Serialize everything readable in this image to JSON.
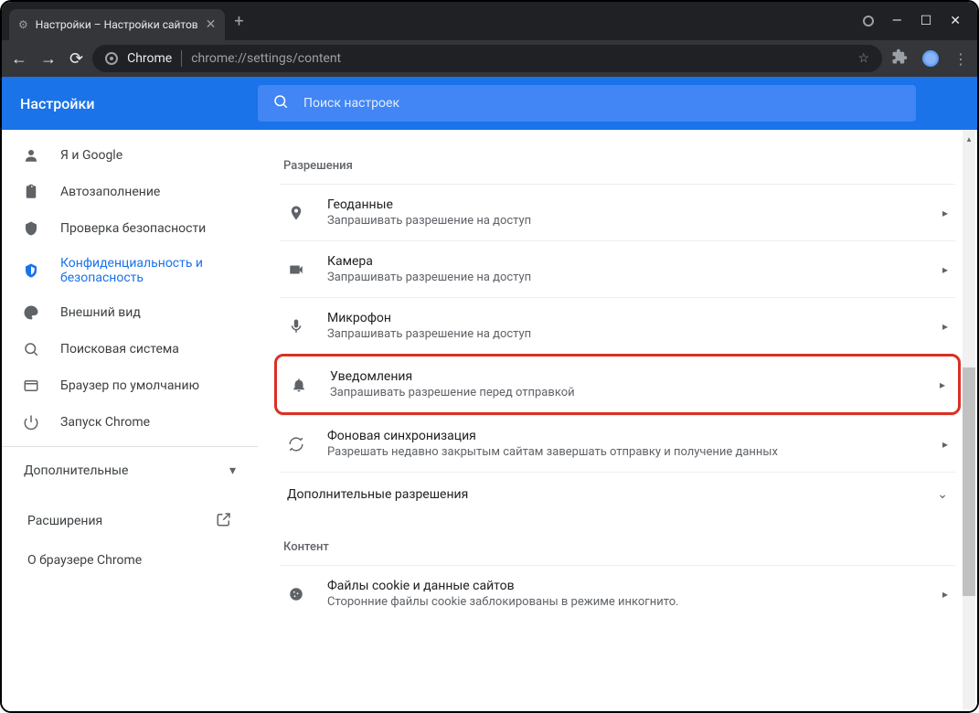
{
  "window": {
    "tab_title": "Настройки – Настройки сайтов"
  },
  "urlbar": {
    "label_chrome": "Chrome",
    "url": "chrome://settings/content"
  },
  "header": {
    "title": "Настройки",
    "search_placeholder": "Поиск настроек"
  },
  "sidebar": {
    "items": [
      {
        "label": "Я и Google"
      },
      {
        "label": "Автозаполнение"
      },
      {
        "label": "Проверка безопасности"
      },
      {
        "label": "Конфиденциальность и безопасность"
      },
      {
        "label": "Внешний вид"
      },
      {
        "label": "Поисковая система"
      },
      {
        "label": "Браузер по умолчанию"
      },
      {
        "label": "Запуск Chrome"
      }
    ],
    "advanced_label": "Дополнительные",
    "extensions_label": "Расширения",
    "about_label": "О браузере Chrome"
  },
  "content": {
    "permissions_label": "Разрешения",
    "rows": [
      {
        "title": "Геоданные",
        "sub": "Запрашивать разрешение на доступ"
      },
      {
        "title": "Камера",
        "sub": "Запрашивать разрешение на доступ"
      },
      {
        "title": "Микрофон",
        "sub": "Запрашивать разрешение на доступ"
      },
      {
        "title": "Уведомления",
        "sub": "Запрашивать разрешение перед отправкой"
      },
      {
        "title": "Фоновая синхронизация",
        "sub": "Разрешать недавно закрытым сайтам завершать отправку и получение данных"
      }
    ],
    "additional_permissions_label": "Дополнительные разрешения",
    "content_label": "Контент",
    "cookie": {
      "title": "Файлы cookie и данные сайтов",
      "sub": "Сторонние файлы cookie заблокированы в режиме инкогнито."
    }
  }
}
